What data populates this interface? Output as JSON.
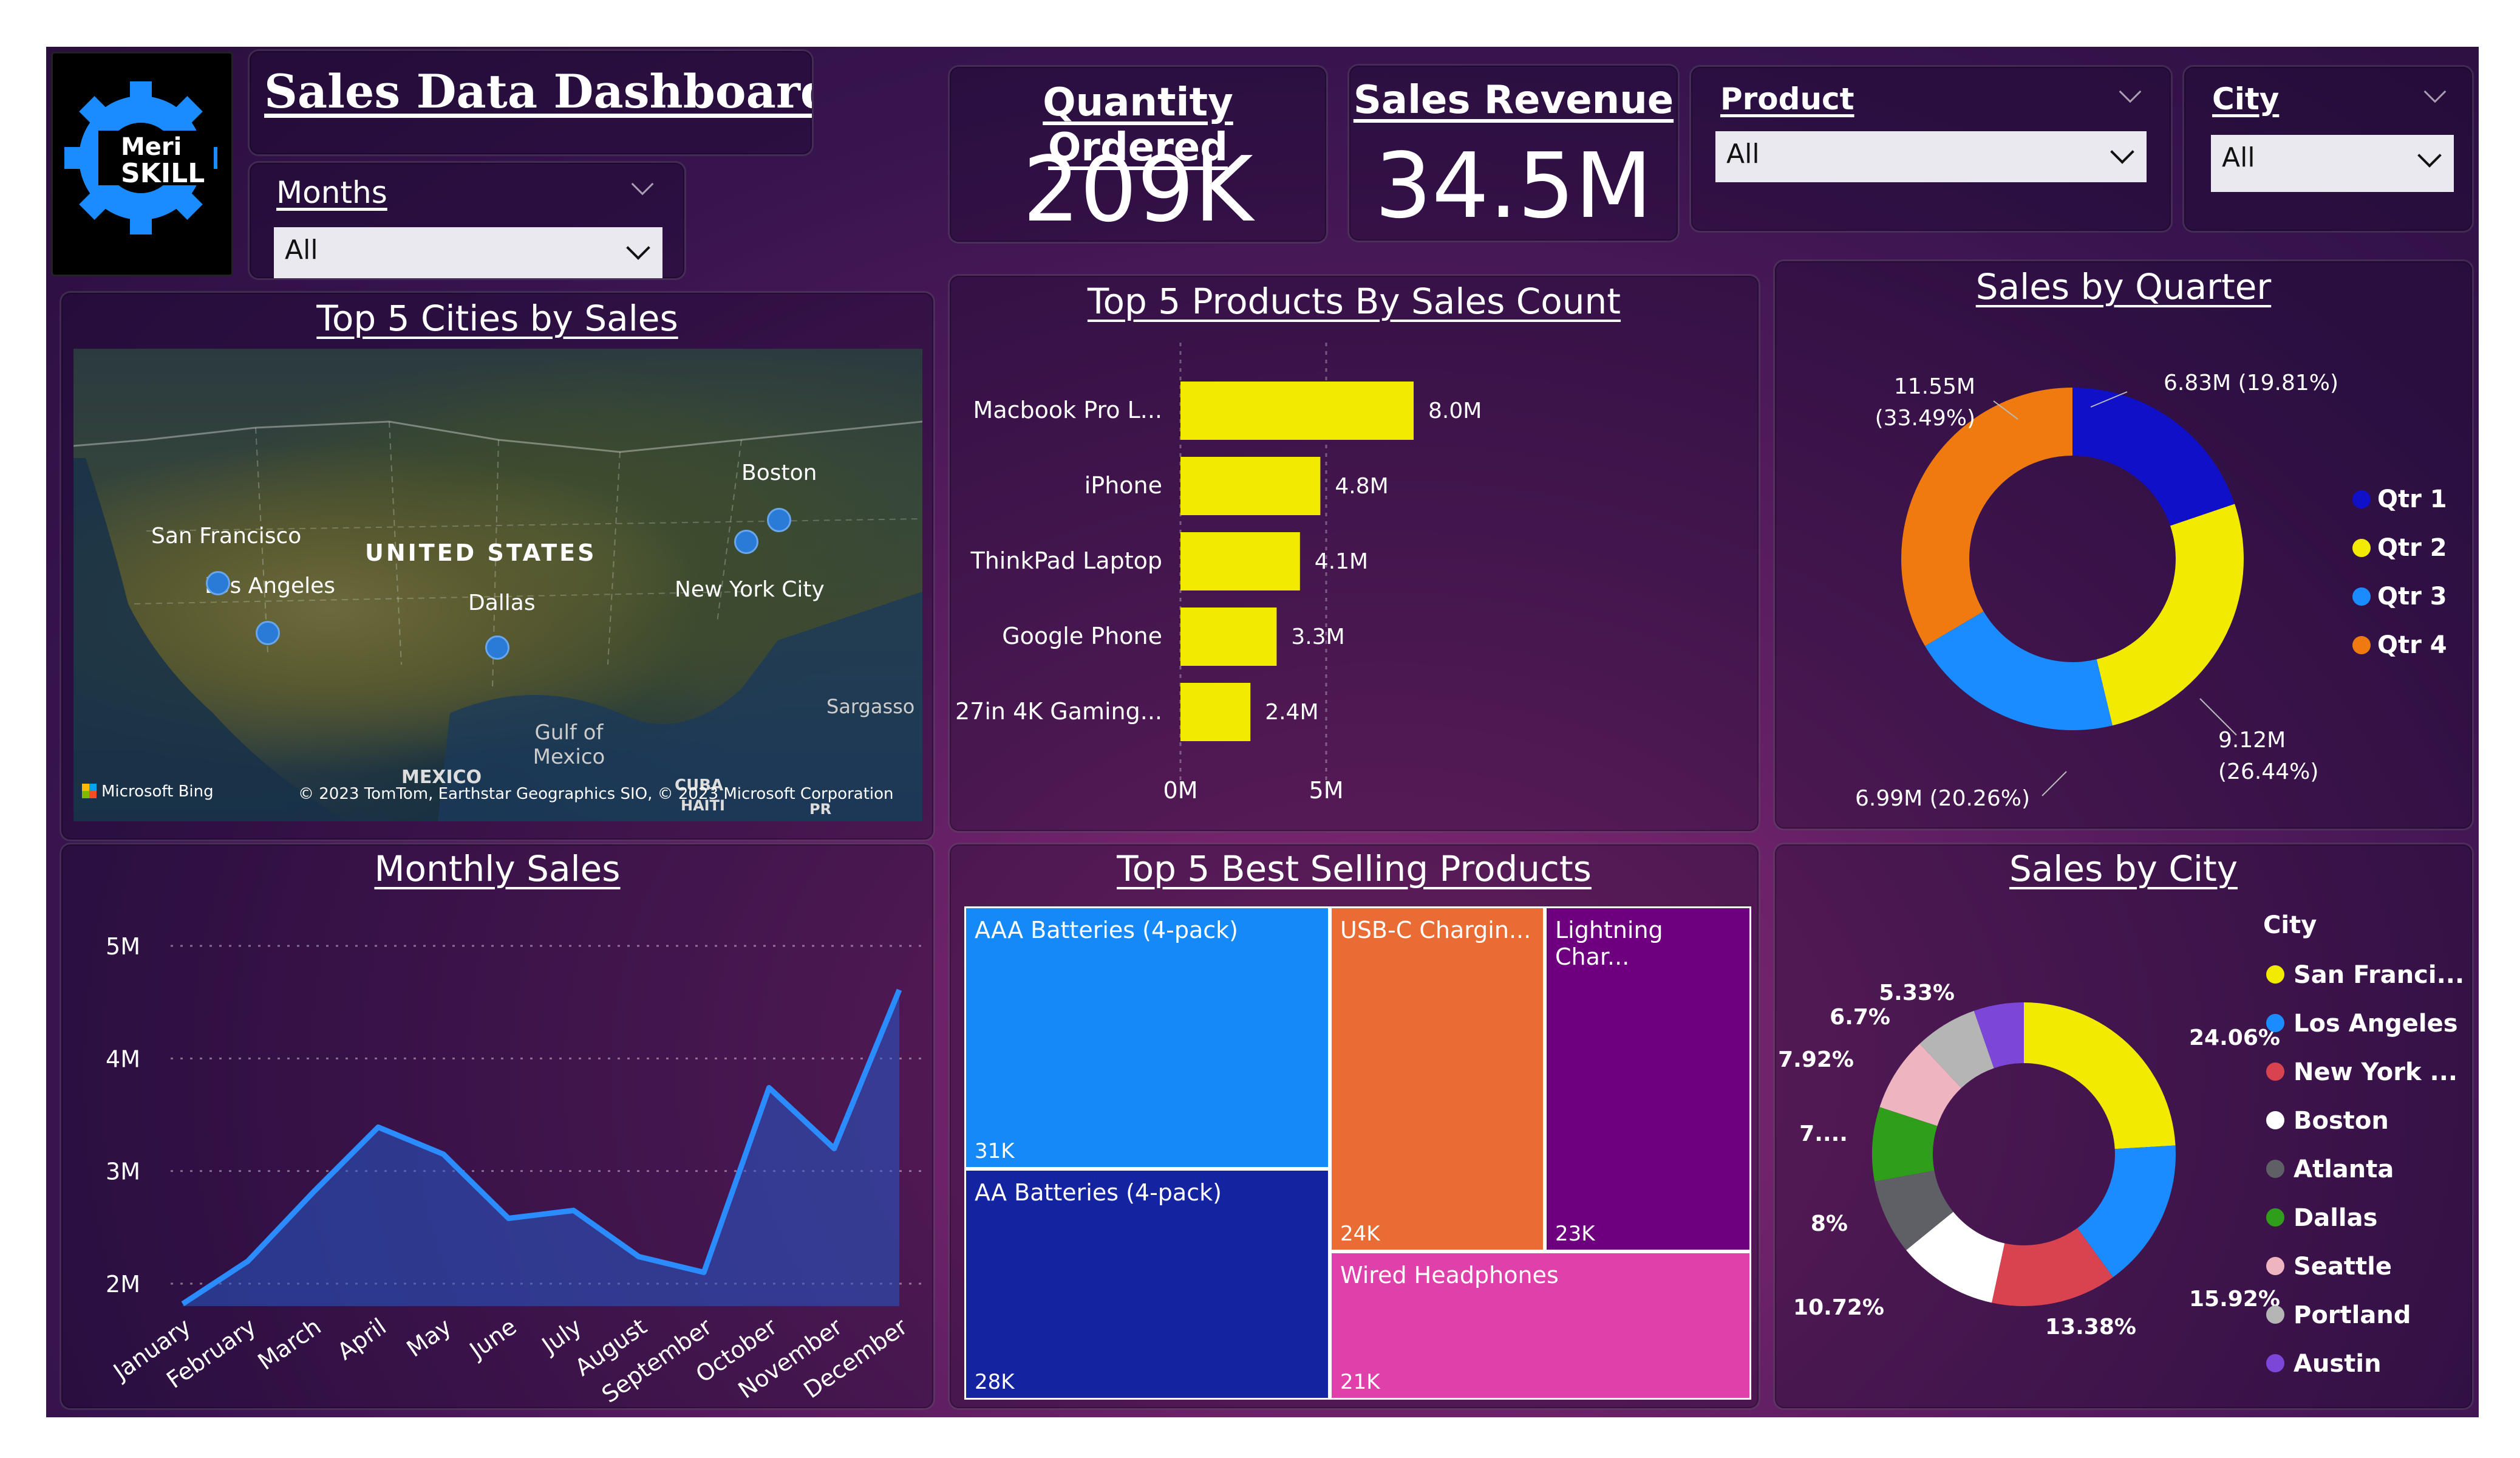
{
  "header": {
    "title": "Sales Data Dashboards",
    "logo_text_1": "Meri",
    "logo_text_2": "SKILL"
  },
  "filters": {
    "months": {
      "label": "Months",
      "value": "All"
    },
    "product": {
      "label": "Product",
      "value": "All"
    },
    "city": {
      "label": "City",
      "value": "All"
    }
  },
  "kpis": {
    "quantity": {
      "label": "Quantity Ordered",
      "value": "209K"
    },
    "revenue": {
      "label": "Sales Revenue",
      "value": "34.5M"
    }
  },
  "map": {
    "title": "Top 5 Cities by Sales",
    "cities": [
      "San Francisco",
      "Los Angeles",
      "Dallas",
      "Boston",
      "New York City"
    ],
    "place_labels": [
      "UNITED STATES",
      "Gulf of Mexico",
      "MEXICO",
      "CUBA",
      "HAITI",
      "PR",
      "Sargasso"
    ],
    "brand": "Microsoft Bing",
    "attribution": "© 2023 TomTom, Earthstar Geographics SIO, © 2023 Microsoft Corporation"
  },
  "colors": {
    "yellow": "#f2ea00",
    "blue_dark": "#1010c8",
    "blue": "#1a8cff",
    "orange": "#ef7a10"
  },
  "chart_data": [
    {
      "type": "bar",
      "title": "Top 5 Products By Sales Count",
      "categories": [
        "Macbook Pro L...",
        "iPhone",
        "ThinkPad Laptop",
        "Google Phone",
        "27in 4K Gaming..."
      ],
      "values": [
        8.0,
        4.8,
        4.1,
        3.3,
        2.4
      ],
      "data_labels": [
        "8.0M",
        "4.8M",
        "4.1M",
        "3.3M",
        "2.4M"
      ],
      "xticks": [
        "0M",
        "5M"
      ],
      "xlim": [
        0,
        10
      ],
      "unit": "M",
      "color": "#f2ea00"
    },
    {
      "type": "pie",
      "title": "Sales by Quarter",
      "labels": [
        "Qtr 1",
        "Qtr 2",
        "Qtr 3",
        "Qtr 4"
      ],
      "values": [
        6.83,
        9.12,
        6.99,
        11.55
      ],
      "percent": [
        19.81,
        26.44,
        20.26,
        33.49
      ],
      "data_labels": [
        "6.83M (19.81%)",
        "9.12M\n(26.44%)",
        "6.99M (20.26%)",
        "11.55M\n(33.49%)"
      ],
      "colors": [
        "#1010c8",
        "#f2ea00",
        "#1a8cff",
        "#ef7a10"
      ]
    },
    {
      "type": "area",
      "title": "Monthly Sales",
      "categories": [
        "January",
        "February",
        "March",
        "April",
        "May",
        "June",
        "July",
        "August",
        "September",
        "October",
        "November",
        "December"
      ],
      "values": [
        1.82,
        2.2,
        2.81,
        3.39,
        3.15,
        2.58,
        2.65,
        2.24,
        2.1,
        3.74,
        3.2,
        4.61
      ],
      "yticks": [
        "2M",
        "3M",
        "4M",
        "5M"
      ],
      "ylim": [
        1.8,
        5.2
      ],
      "unit": "M"
    },
    {
      "type": "treemap",
      "title": "Top 5 Best Selling Products",
      "labels": [
        "AAA Batteries (4-pack)",
        "AA Batteries (4-pack)",
        "USB-C Chargin...",
        "Lightning Char...",
        "Wired Headphones"
      ],
      "values": [
        31,
        28,
        24,
        23,
        21
      ],
      "data_labels": [
        "31K",
        "28K",
        "24K",
        "23K",
        "21K"
      ],
      "colors": [
        "#1589f7",
        "#1424a0",
        "#e86c34",
        "#6e0080",
        "#e040aa"
      ]
    },
    {
      "type": "pie",
      "title": "Sales by City",
      "legend_title": "City",
      "labels": [
        "San Franci...",
        "Los Angeles",
        "New York ...",
        "Boston",
        "Atlanta",
        "Dallas",
        "Seattle",
        "Portland",
        "Austin"
      ],
      "percent": [
        24.06,
        15.92,
        13.38,
        10.72,
        8.0,
        7.9,
        7.92,
        6.7,
        5.33
      ],
      "data_labels": [
        "24.06%",
        "15.92%",
        "13.38%",
        "10.72%",
        "8%",
        "7....",
        "7.92%",
        "6.7%",
        "5.33%"
      ],
      "colors": [
        "#f2ea00",
        "#1a8cff",
        "#d9434f",
        "#ffffff",
        "#5f5f66",
        "#2f9e1a",
        "#eeb4bf",
        "#b5b5b5",
        "#7c46d8"
      ]
    }
  ]
}
